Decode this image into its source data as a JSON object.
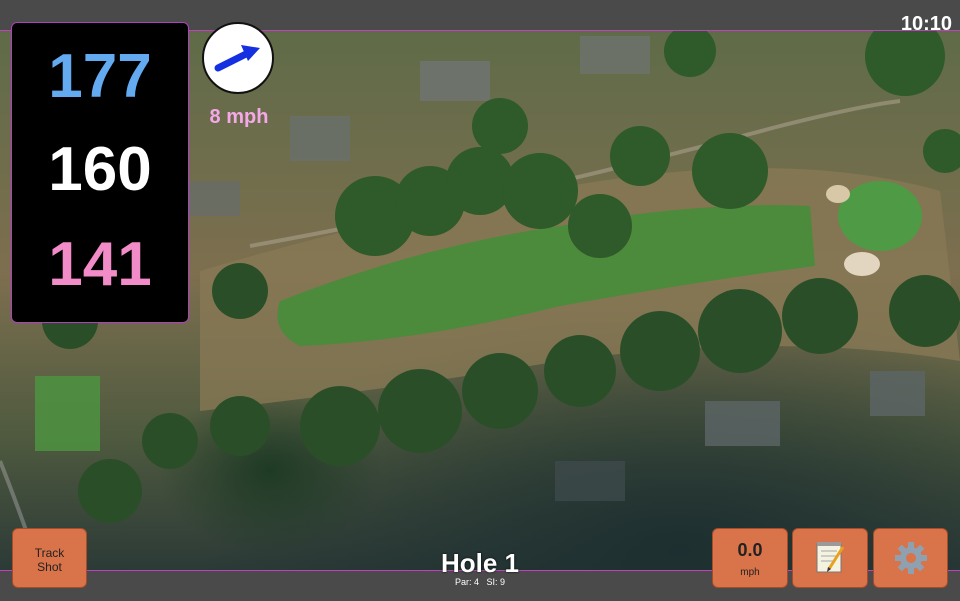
{
  "status_bar": {
    "time": "10:10"
  },
  "distances": {
    "back": "177",
    "middle": "160",
    "front": "141"
  },
  "wind": {
    "speed": "8 mph",
    "icon": "wind-arrow-icon"
  },
  "hole": {
    "title": "Hole 1",
    "par_label": "Par: 4",
    "si_label": "SI: 9"
  },
  "buttons": {
    "track_shot_line1": "Track",
    "track_shot_line2": "Shot",
    "speed_value": "0.0",
    "speed_unit": "mph",
    "notes_icon": "notepad-icon",
    "settings_icon": "gear-icon"
  },
  "colors": {
    "back": "#64aaf0",
    "middle": "#ffffff",
    "front": "#f28cc8",
    "wind_text": "#f5a8e8",
    "button": "#d9734a",
    "accent_border": "#c040c0"
  }
}
